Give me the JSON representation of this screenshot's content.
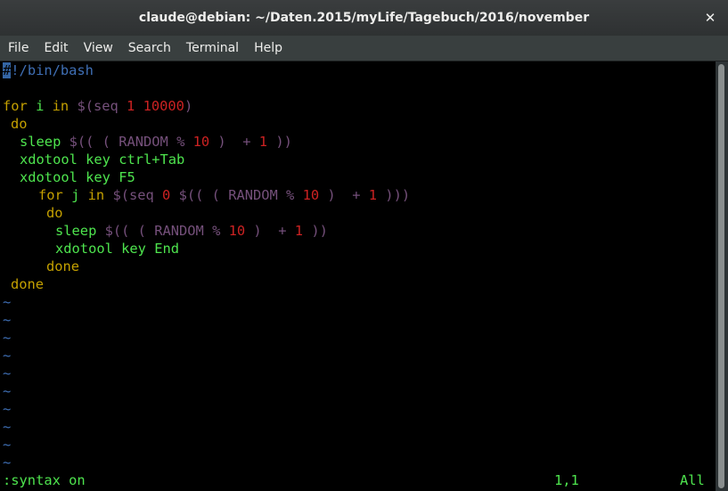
{
  "window": {
    "title": "claude@debian: ~/Daten.2015/myLife/Tagebuch/2016/november",
    "close_glyph": "✕"
  },
  "menu": {
    "items": [
      "File",
      "Edit",
      "View",
      "Search",
      "Terminal",
      "Help"
    ]
  },
  "editor": {
    "cursor_char": "#",
    "shebang_rest": "!/bin/bash",
    "lines": {
      "l3": {
        "for": "for",
        "var": " i ",
        "in": "in",
        "sub_open": " $(seq ",
        "n1": "1",
        "sp": " ",
        "n2": "10000",
        "close": ")"
      },
      "l4": {
        "do": "do"
      },
      "l5": {
        "sleep": "sleep",
        "expr_a": " $(( ( RANDOM % ",
        "n1": "10",
        "expr_b": " )  + ",
        "n2": "1",
        "expr_c": " ))"
      },
      "l6": {
        "text": "xdotool key ctrl+Tab"
      },
      "l7": {
        "text": "xdotool key F5"
      },
      "l8": {
        "for": "for",
        "var": " j ",
        "in": "in",
        "sub_a": " $(seq ",
        "n0": "0",
        "sub_b": " $(( ( RANDOM % ",
        "n1": "10",
        "sub_c": " )  + ",
        "n2": "1",
        "sub_d": " )))"
      },
      "l9": {
        "do": "do"
      },
      "l10": {
        "sleep": "sleep",
        "expr_a": " $(( ( RANDOM % ",
        "n1": "10",
        "expr_b": " )  + ",
        "n2": "1",
        "expr_c": " ))"
      },
      "l11": {
        "text": "xdotool key End"
      },
      "l12": {
        "done": "done"
      },
      "l13": {
        "done": "done"
      }
    },
    "tilde": "~",
    "empty_line_marker_count": 10
  },
  "statusline": {
    "command": ":syntax on",
    "position": "1,1",
    "scroll": "All"
  },
  "colors": {
    "keyword": "#c4a000",
    "command": "#4ee44e",
    "number": "#cc2222",
    "substitution": "#75507b",
    "shebang": "#3f6fb5",
    "tilde": "#3f6fb5",
    "background": "#000000"
  }
}
